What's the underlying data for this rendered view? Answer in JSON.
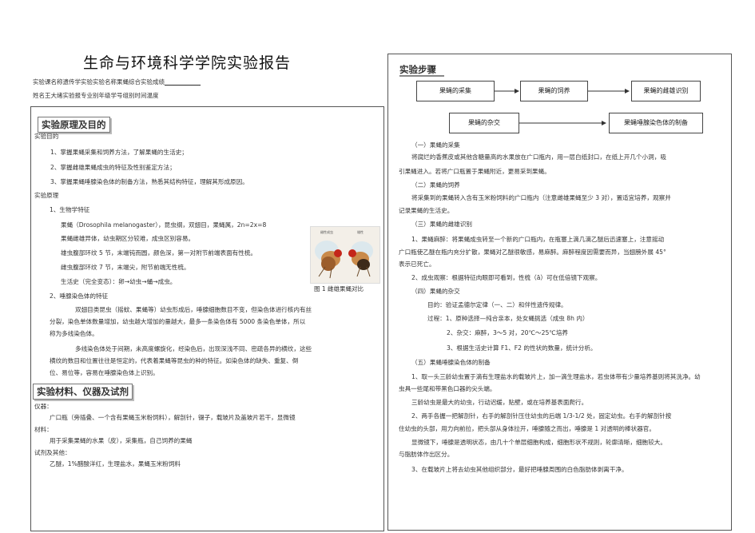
{
  "header": {
    "title": "生命与环境科学学院实验报告",
    "line1": "实验课名称遗传学实验实验名称果蝇综合实验成绩",
    "line1_blank": "____________",
    "line2": "姓名王大绪实验报专业别年级学号组别时间温度"
  },
  "left": {
    "section1_heading": "实验原理及目的",
    "purpose_label": "实验目的",
    "purpose_items": [
      "1、掌握果蝇采集和饲养方法，了解果蝇的生活史；",
      "2、掌握雌雄果蝇成虫的特征及性别鉴定方法；",
      "3、掌握果蝇唾腺染色体的制备方法，熟悉其结构特征，理解其形成原因。"
    ],
    "principle_label": "实验原理",
    "bio_title": "1、生物学特征",
    "bio_lines": [
      "果蝇（Drosophila melanogaster），昆虫纲，双翅目，果蝇属，2n=2x=8",
      "果蝇雌雄异体，幼虫期区分较难，成虫区别容易。",
      "雄虫腹部环纹 5 节，末端钝而圆，颜色深，第一对附节前端表面有性梳。",
      "雌虫腹部环纹 7 节，末端尖，附节前端无性梳。",
      "生活史（完全变态）：卵→幼虫→蛹→成虫。"
    ],
    "figure_caption": "图 1 雌雄果蝇对比",
    "figure_labels": [
      "雌性成虫",
      "雄性"
    ],
    "chrom_title": "2、唾腺染色体的特征",
    "chrom_para1": [
      "双翅目类昆虫（摇蚊、果蝇等）幼虫形成后，唾腺细胞数目不变，但染色体进行核内有丝",
      "分裂，染色单体数量增加，幼虫越大增加的量越大，最多一条染色体有 5000 条染色单体，所以",
      "称为多线染色体。"
    ],
    "chrom_para2": [
      "多线染色体处于间期，未高度螺旋化，经染色后，出现深浅不同、密疏各异的横纹，这些",
      "横纹的数目和位置往往是恒定的，代表着果蝇等昆虫的种的特征。如染色体的缺失、重复、倒",
      "位、易位等，容易在唾腺染色体上识别。"
    ],
    "section2_heading": "实验材料、仪器及试剂",
    "instruments_label": "仪器：",
    "instruments_text": "广口瓶（旁插叠、一个含有果蝇玉米粉饲料），解剖针，镊子，载玻片及盖玻片若干，显微镜",
    "materials_label": "材料：",
    "materials_text": "用于采集果蝇的水果（皮），采集瓶，自己饲养的果蝇",
    "reagents_label": "试剂及其他：",
    "reagents_text": "乙醚，1%醋酸洋红，生理盐水，果蝇玉米粉饲料"
  },
  "right": {
    "heading": "实验步骤",
    "flow": [
      "果蝇的采集",
      "果蝇的饲养",
      "果蝇的雌雄识别",
      "果蝇的杂交",
      "果蝇唾腺染色体的制备"
    ],
    "lines": [
      {
        "text": "（一）果蝇的采集",
        "indent": 16
      },
      {
        "text": "将腐烂的香蕉皮或其他含糖量高的水果放在广口瓶内，用一层白纸封口，在纸上开几个小洞，吸",
        "indent": 16
      },
      {
        "text": "引果蝇进入。若将广口瓶置于果蝇附近，更易采到果蝇。",
        "indent": 0
      },
      {
        "text": "（二）果蝇的饲养",
        "indent": 16
      },
      {
        "text": "将采集到的果蝇转入含有玉米粉饲料的广口瓶内（注意雌雄果蝇至少 3 对），置适宜培养，观察并",
        "indent": 16
      },
      {
        "text": "记录果蝇的生活史。",
        "indent": 0
      },
      {
        "text": "（三）果蝇的雌雄识别",
        "indent": 16
      },
      {
        "text": "1、果蝇麻醉：将果蝇成虫转至一个新的广口瓶内，在瓶塞上滴几滴乙醚后迅速塞上，注意摇动",
        "indent": 16
      },
      {
        "text": "广口瓶使乙醚在瓶内充分扩散，果蝇对乙醚很敏感，易麻醉。麻醉程度因需要而异，当翅膀外展 45°",
        "indent": 0
      },
      {
        "text": "表示已死亡。",
        "indent": 0
      },
      {
        "text": "2、成虫观察：根据特征肉眼即可看到，性梳（ā）可在低倍镜下观察。",
        "indent": 16
      },
      {
        "text": "（四）果蝇的杂交",
        "indent": 16
      },
      {
        "text": "目的：验证孟德尔定律（一、二）和伴性遗传规律。",
        "indent": 36
      },
      {
        "text": "过程：1、原种选择—纯合亲本，处女蝇挑选（成虫 8h 内）",
        "indent": 36
      },
      {
        "text": "2、杂交：麻醉，3～5 对，20℃～25℃培养",
        "indent": 60
      },
      {
        "text": "3、根据生活史计算 F1、F2 的性状的数量，统计分析。",
        "indent": 60
      },
      {
        "text": "（五）果蝇唾腺染色体的制备",
        "indent": 16
      },
      {
        "text": "1、取一头三龄幼虫置于滴有生理盐水的载玻片上，加一滴生理盐水，若虫体带有少量培养基则将其洗净。幼",
        "indent": 16
      },
      {
        "text": "虫具一些尾和带黑色口器的尖头端。",
        "indent": 0
      },
      {
        "text": "三龄幼虫是最大的幼虫，行动迟缓，贴壁，或在培养基表面爬行。",
        "indent": 16
      },
      {
        "text": "2、两手各握一把解剖针，右手的解剖针压住幼虫的后端 1/3-1/2 处，固定幼虫。右手的解剖针按",
        "indent": 16
      },
      {
        "text": "住幼虫的头部，用力向前拉，把头部从身体拉开，唾腺随之而出，唾腺是 1 对透明的棒状器官。",
        "indent": 0
      },
      {
        "text": "显微镜下，唾腺是透明状态，由几十个单层细胞构成，细胞形状不规则，轮廓清晰，细胞较大。",
        "indent": 16
      },
      {
        "text": "与脂肪体作出区分。",
        "indent": 0
      },
      {
        "text": "3、在载玻片上将去幼虫其他组织部分，最好把唾腺周围的白色脂肪体剥离干净。",
        "indent": 16
      }
    ]
  }
}
